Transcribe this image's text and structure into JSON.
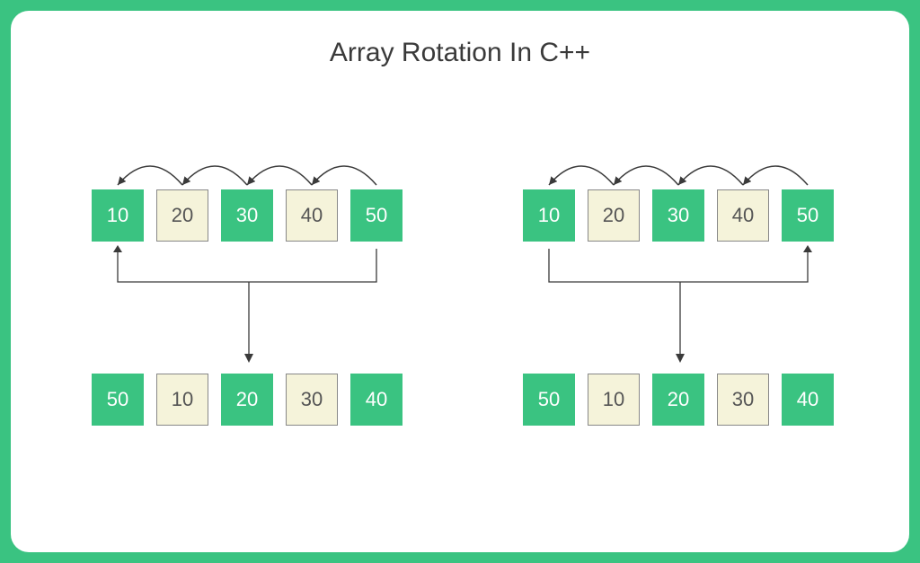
{
  "title": "Array Rotation In C++",
  "left": {
    "top": [
      "10",
      "20",
      "30",
      "40",
      "50"
    ],
    "bottom": [
      "50",
      "10",
      "20",
      "30",
      "40"
    ]
  },
  "right": {
    "top": [
      "10",
      "20",
      "30",
      "40",
      "50"
    ],
    "bottom": [
      "50",
      "10",
      "20",
      "30",
      "40"
    ]
  }
}
